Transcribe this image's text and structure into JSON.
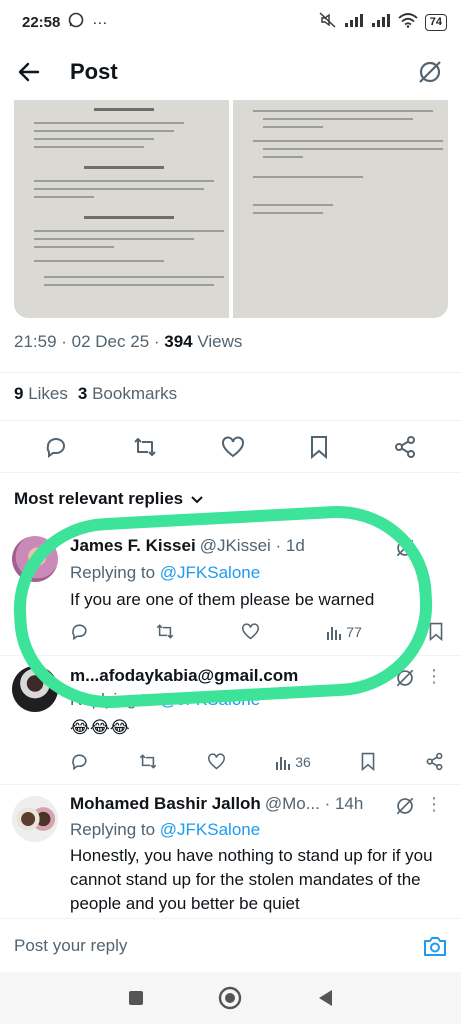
{
  "status": {
    "time": "22:58",
    "battery": "74"
  },
  "header": {
    "title": "Post"
  },
  "post": {
    "time": "21:59 · 02 Dec 25 · ",
    "views": "394",
    "views_label": " Views",
    "likes": "9",
    "likes_label": "Likes",
    "bookmarks": "3",
    "bookmarks_label": "Bookmarks"
  },
  "replies_filter": "Most relevant replies",
  "replies": [
    {
      "name": "James F. Kissei",
      "handle": "@JKissei · 1d",
      "replying_prefix": "Replying to ",
      "replying_to": "@JFKSalone",
      "text": "If you are one of them please be warned",
      "views": "77"
    },
    {
      "name": "m...afodaykabia@gmail.com",
      "handle": "",
      "replying_prefix": "Replying to ",
      "replying_to": "@JFKSalone",
      "text": "😂😂😂",
      "views": "36"
    },
    {
      "name": "Mohamed Bashir Jalloh",
      "handle": "@Mo... · 14h",
      "replying_prefix": "Replying to ",
      "replying_to": "@JFKSalone",
      "text": "Honestly, you have nothing to stand up for if you cannot stand up for the stolen mandates of the people and you better be quiet"
    }
  ],
  "compose": {
    "placeholder": "Post your reply"
  },
  "colors": {
    "accent": "#1d9bf0",
    "highlight": "#3ee39a",
    "muted": "#536471"
  }
}
